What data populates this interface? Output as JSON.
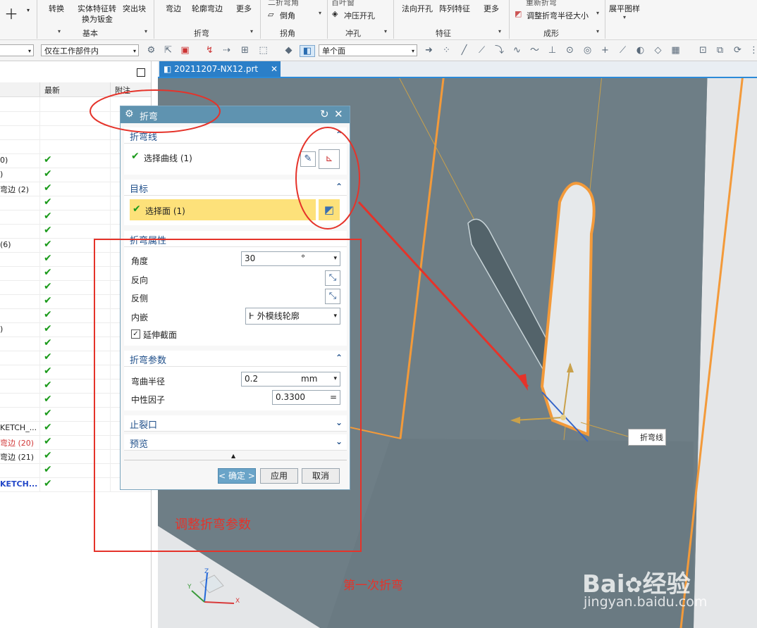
{
  "ribbon": {
    "items": [
      "转换",
      "实体特征转",
      "换为钣金",
      "突出块",
      "弯边",
      "轮廓弯边",
      "更多",
      "倒角",
      "冲压开孔",
      "法向开孔",
      "阵列特征",
      "更多",
      "调整折弯半径大小",
      "展平图样"
    ],
    "groups": [
      "基本",
      "折弯",
      "拐角",
      "冲孔",
      "特征",
      "成形"
    ],
    "partial_items": [
      "二折弯角",
      "百叶窗",
      "重新折弯"
    ]
  },
  "toolbar": {
    "filter_scope": "仅在工作部件内",
    "selection_rule": "单个面"
  },
  "navigator": {
    "col_latest": "最新",
    "col_notes": "附注",
    "rows": [
      {
        "text": "",
        "check": false
      },
      {
        "text": "",
        "check": false
      },
      {
        "text": "",
        "check": false
      },
      {
        "text": "",
        "check": false
      },
      {
        "text": "0)",
        "check": true
      },
      {
        "text": ")",
        "check": true
      },
      {
        "text": "弯边 (2)",
        "check": true
      },
      {
        "text": "",
        "check": true
      },
      {
        "text": "",
        "check": true
      },
      {
        "text": "",
        "check": true
      },
      {
        "text": "(6)",
        "check": true
      },
      {
        "text": "",
        "check": true
      },
      {
        "text": "",
        "check": true
      },
      {
        "text": "",
        "check": true
      },
      {
        "text": "",
        "check": true
      },
      {
        "text": "",
        "check": true
      },
      {
        "text": ")",
        "check": true
      },
      {
        "text": "",
        "check": true
      },
      {
        "text": "",
        "check": true
      },
      {
        "text": "",
        "check": true
      },
      {
        "text": "",
        "check": true
      },
      {
        "text": "",
        "check": true
      },
      {
        "text": "",
        "check": true
      },
      {
        "text": "KETCH_...",
        "check": true
      },
      {
        "text": "弯边 (20)",
        "check": true,
        "color": "#d23a3a"
      },
      {
        "text": "弯边 (21)",
        "check": true
      },
      {
        "text": "",
        "check": true
      },
      {
        "text": "KETCH...",
        "check": true,
        "color": "#2448c8"
      }
    ]
  },
  "tab": {
    "label": "20211207-NX12.prt"
  },
  "dialog": {
    "title": "折弯",
    "sec_bend_line": "折弯线",
    "select_curve": "选择曲线 (1)",
    "sec_target": "目标",
    "select_face": "选择面 (1)",
    "sec_props": "折弯属性",
    "angle_label": "角度",
    "angle_value": "30",
    "angle_unit": "°",
    "reverse_label": "反向",
    "reverse_side_label": "反侧",
    "inset_label": "内嵌",
    "inset_value": "外模线轮廓",
    "extend_label": "延伸截面",
    "sec_params": "折弯参数",
    "radius_label": "弯曲半径",
    "radius_value": "0.2",
    "radius_unit": "mm",
    "kfactor_label": "中性因子",
    "kfactor_value": "0.3300",
    "sec_relief": "止裂口",
    "sec_preview": "预览",
    "ok": "< 确定 >",
    "apply": "应用",
    "cancel": "取消"
  },
  "viewport": {
    "callout": "折弯线",
    "axis_x": "X",
    "axis_y": "Y",
    "axis_z": "Z"
  },
  "annotations": {
    "adjust": "调整折弯参数",
    "first_bend": "第一次折弯"
  },
  "watermark": {
    "brand": "Bai",
    "brand2": "经验",
    "url": "jingyan.baidu.com"
  },
  "colors": {
    "accent": "#5f93b0",
    "highlight": "#fde17a",
    "annotation": "#e5332a",
    "edge": "#f39a3a"
  }
}
